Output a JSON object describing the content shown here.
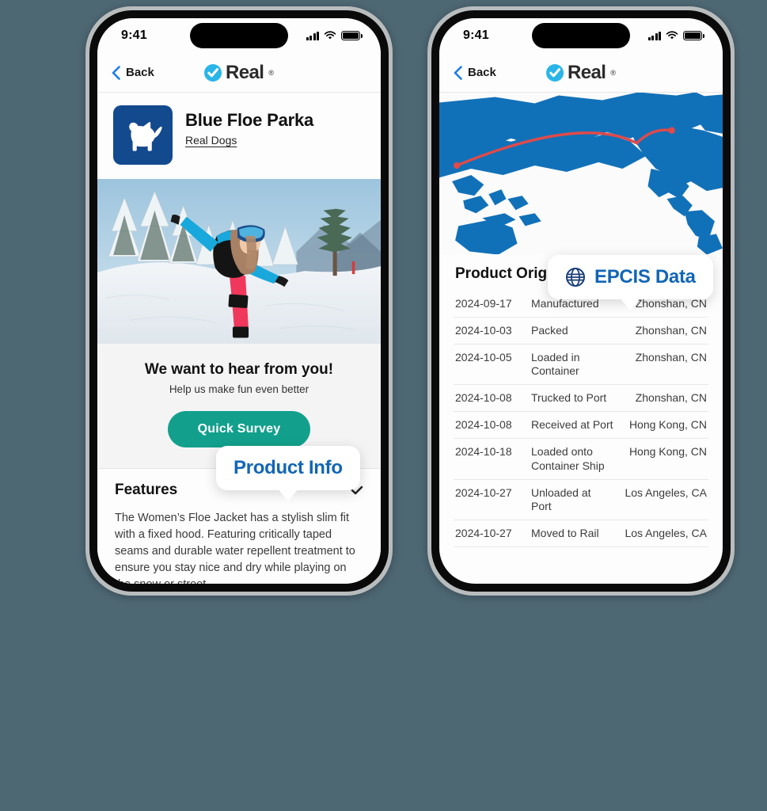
{
  "background_color": "#4d6773",
  "accent_colors": {
    "brand_blue": "#1266b5",
    "logo_cyan": "#29b5e8",
    "survey_teal": "#12a08c",
    "tile_navy": "#134a8e",
    "map_blue": "#1171b8",
    "route_red": "#e04a4a"
  },
  "left_phone": {
    "status_bar": {
      "time": "9:41",
      "signal_icon": "cellular-bars-icon",
      "wifi_icon": "wifi-icon",
      "battery_icon": "battery-icon"
    },
    "nav": {
      "back_label": "Back",
      "back_icon": "chevron-left-icon",
      "brand_name": "Real",
      "brand_trademark": "®",
      "brand_icon": "check-circle-icon"
    },
    "product": {
      "brand_tile_icon": "dog-silhouette-icon",
      "title": "Blue Floe Parka",
      "brand_link": "Real Dogs"
    },
    "hero_image_alt": "snowboarder-in-snow-photo",
    "survey": {
      "heading": "We want to hear from you!",
      "subheading": "Help us make fun even better",
      "button_label": "Quick  Survey"
    },
    "callout": {
      "label": "Product Info"
    },
    "features": {
      "title": "Features",
      "expand_icon": "chevron-down-icon",
      "body": "The Women’s Floe Jacket has a stylish slim fit with a fixed hood. Featuring critically taped seams and durable water repellent treatment to ensure you stay nice and dry while playing on the snow or street."
    }
  },
  "right_phone": {
    "status_bar": {
      "time": "9:41",
      "signal_icon": "cellular-bars-icon",
      "wifi_icon": "wifi-icon",
      "battery_icon": "battery-icon"
    },
    "nav": {
      "back_label": "Back",
      "back_icon": "chevron-left-icon",
      "brand_name": "Real",
      "brand_trademark": "®",
      "brand_icon": "check-circle-icon"
    },
    "map_alt": "world-map-with-shipping-route",
    "callout": {
      "label": "EPCIS Data",
      "icon": "globe-icon"
    },
    "section": {
      "title": "Product Origin",
      "expand_icon": "chevron-down-icon"
    },
    "events": [
      {
        "date": "2024-09-17",
        "event": "Manufactured",
        "location": "Zhonshan, CN"
      },
      {
        "date": "2024-10-03",
        "event": "Packed",
        "location": "Zhonshan, CN"
      },
      {
        "date": "2024-10-05",
        "event": "Loaded in Container",
        "location": "Zhonshan, CN"
      },
      {
        "date": "2024-10-08",
        "event": "Trucked to Port",
        "location": "Zhonshan, CN"
      },
      {
        "date": "2024-10-08",
        "event": "Received at Port",
        "location": "Hong Kong, CN"
      },
      {
        "date": "2024-10-18",
        "event": "Loaded onto Container Ship",
        "location": "Hong Kong, CN"
      },
      {
        "date": "2024-10-27",
        "event": "Unloaded at Port",
        "location": "Los Angeles, CA"
      },
      {
        "date": "2024-10-27",
        "event": "Moved to Rail",
        "location": "Los Angeles, CA"
      }
    ]
  }
}
